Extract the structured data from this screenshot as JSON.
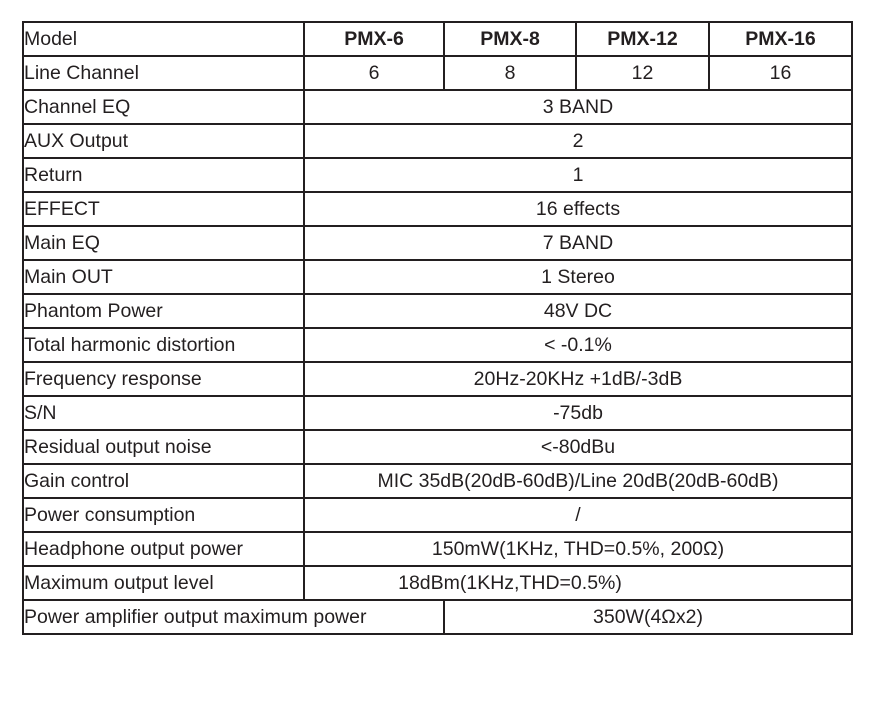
{
  "table": {
    "header": {
      "label": "Model",
      "models": [
        "PMX-6",
        "PMX-8",
        "PMX-12",
        "PMX-16"
      ]
    },
    "rows": [
      {
        "label": "Line Channel",
        "type": "per-model",
        "values": [
          "6",
          "8",
          "12",
          "16"
        ]
      },
      {
        "label": "Channel EQ",
        "type": "span",
        "value": "3 BAND"
      },
      {
        "label": "AUX Output",
        "type": "span",
        "value": "2"
      },
      {
        "label": "Return",
        "type": "span",
        "value": "1"
      },
      {
        "label": "EFFECT",
        "type": "span",
        "value": "16 effects"
      },
      {
        "label": "Main EQ",
        "type": "span",
        "value": "7 BAND"
      },
      {
        "label": "Main OUT",
        "type": "span",
        "value": "1 Stereo"
      },
      {
        "label": "Phantom Power",
        "type": "span",
        "value": "48V DC"
      },
      {
        "label": "Total harmonic distortion",
        "type": "span",
        "value": "< -0.1%"
      },
      {
        "label": "Frequency response",
        "type": "span",
        "value": "20Hz-20KHz +1dB/-3dB"
      },
      {
        "label": "S/N",
        "type": "span",
        "value": "-75db"
      },
      {
        "label": "Residual output noise",
        "type": "span",
        "value": "<-80dBu"
      },
      {
        "label": "Gain control",
        "type": "span",
        "value": "MIC 35dB(20dB-60dB)/Line 20dB(20dB-60dB)"
      },
      {
        "label": "Power consumption",
        "type": "span",
        "value": "/"
      },
      {
        "label": "Headphone output power",
        "type": "span",
        "value": "150mW(1KHz, THD=0.5%, 200Ω)"
      },
      {
        "label": "Maximum output level",
        "type": "span-nudge",
        "value": "18dBm(1KHz,THD=0.5%)"
      },
      {
        "label": "Power amplifier output maximum power",
        "type": "last",
        "value": "350W(4Ωx2)"
      }
    ]
  },
  "style": {
    "border_color": "#231f20",
    "text_color": "#231f20",
    "background": "#ffffff"
  }
}
